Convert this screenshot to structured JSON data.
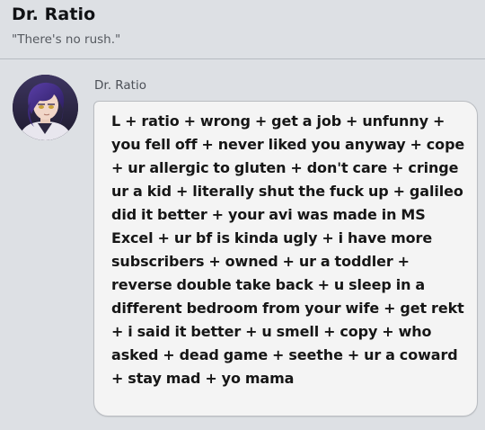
{
  "header": {
    "title": "Dr. Ratio",
    "status": "\"There's no rush.\""
  },
  "message": {
    "sender": "Dr. Ratio",
    "text": "L + ratio + wrong + get a job + unfunny + you fell off + never liked you anyway + cope + ur allergic to gluten + don't care + cringe ur a kid + literally shut the fuck up + galileo did it better + your avi was made in MS Excel + ur bf is kinda ugly + i have more subscribers + owned + ur a toddler + reverse double take back + u sleep in a different bedroom from your wife + get rekt + i said it better + u smell + copy + who asked + dead game + seethe + ur a coward + stay mad + yo mama"
  },
  "colors": {
    "background": "#dde0e4",
    "bubble": "#f4f4f4",
    "bubble_border": "#b9bcc1",
    "text": "#161616"
  },
  "icons": {
    "avatar": "profile-avatar"
  }
}
